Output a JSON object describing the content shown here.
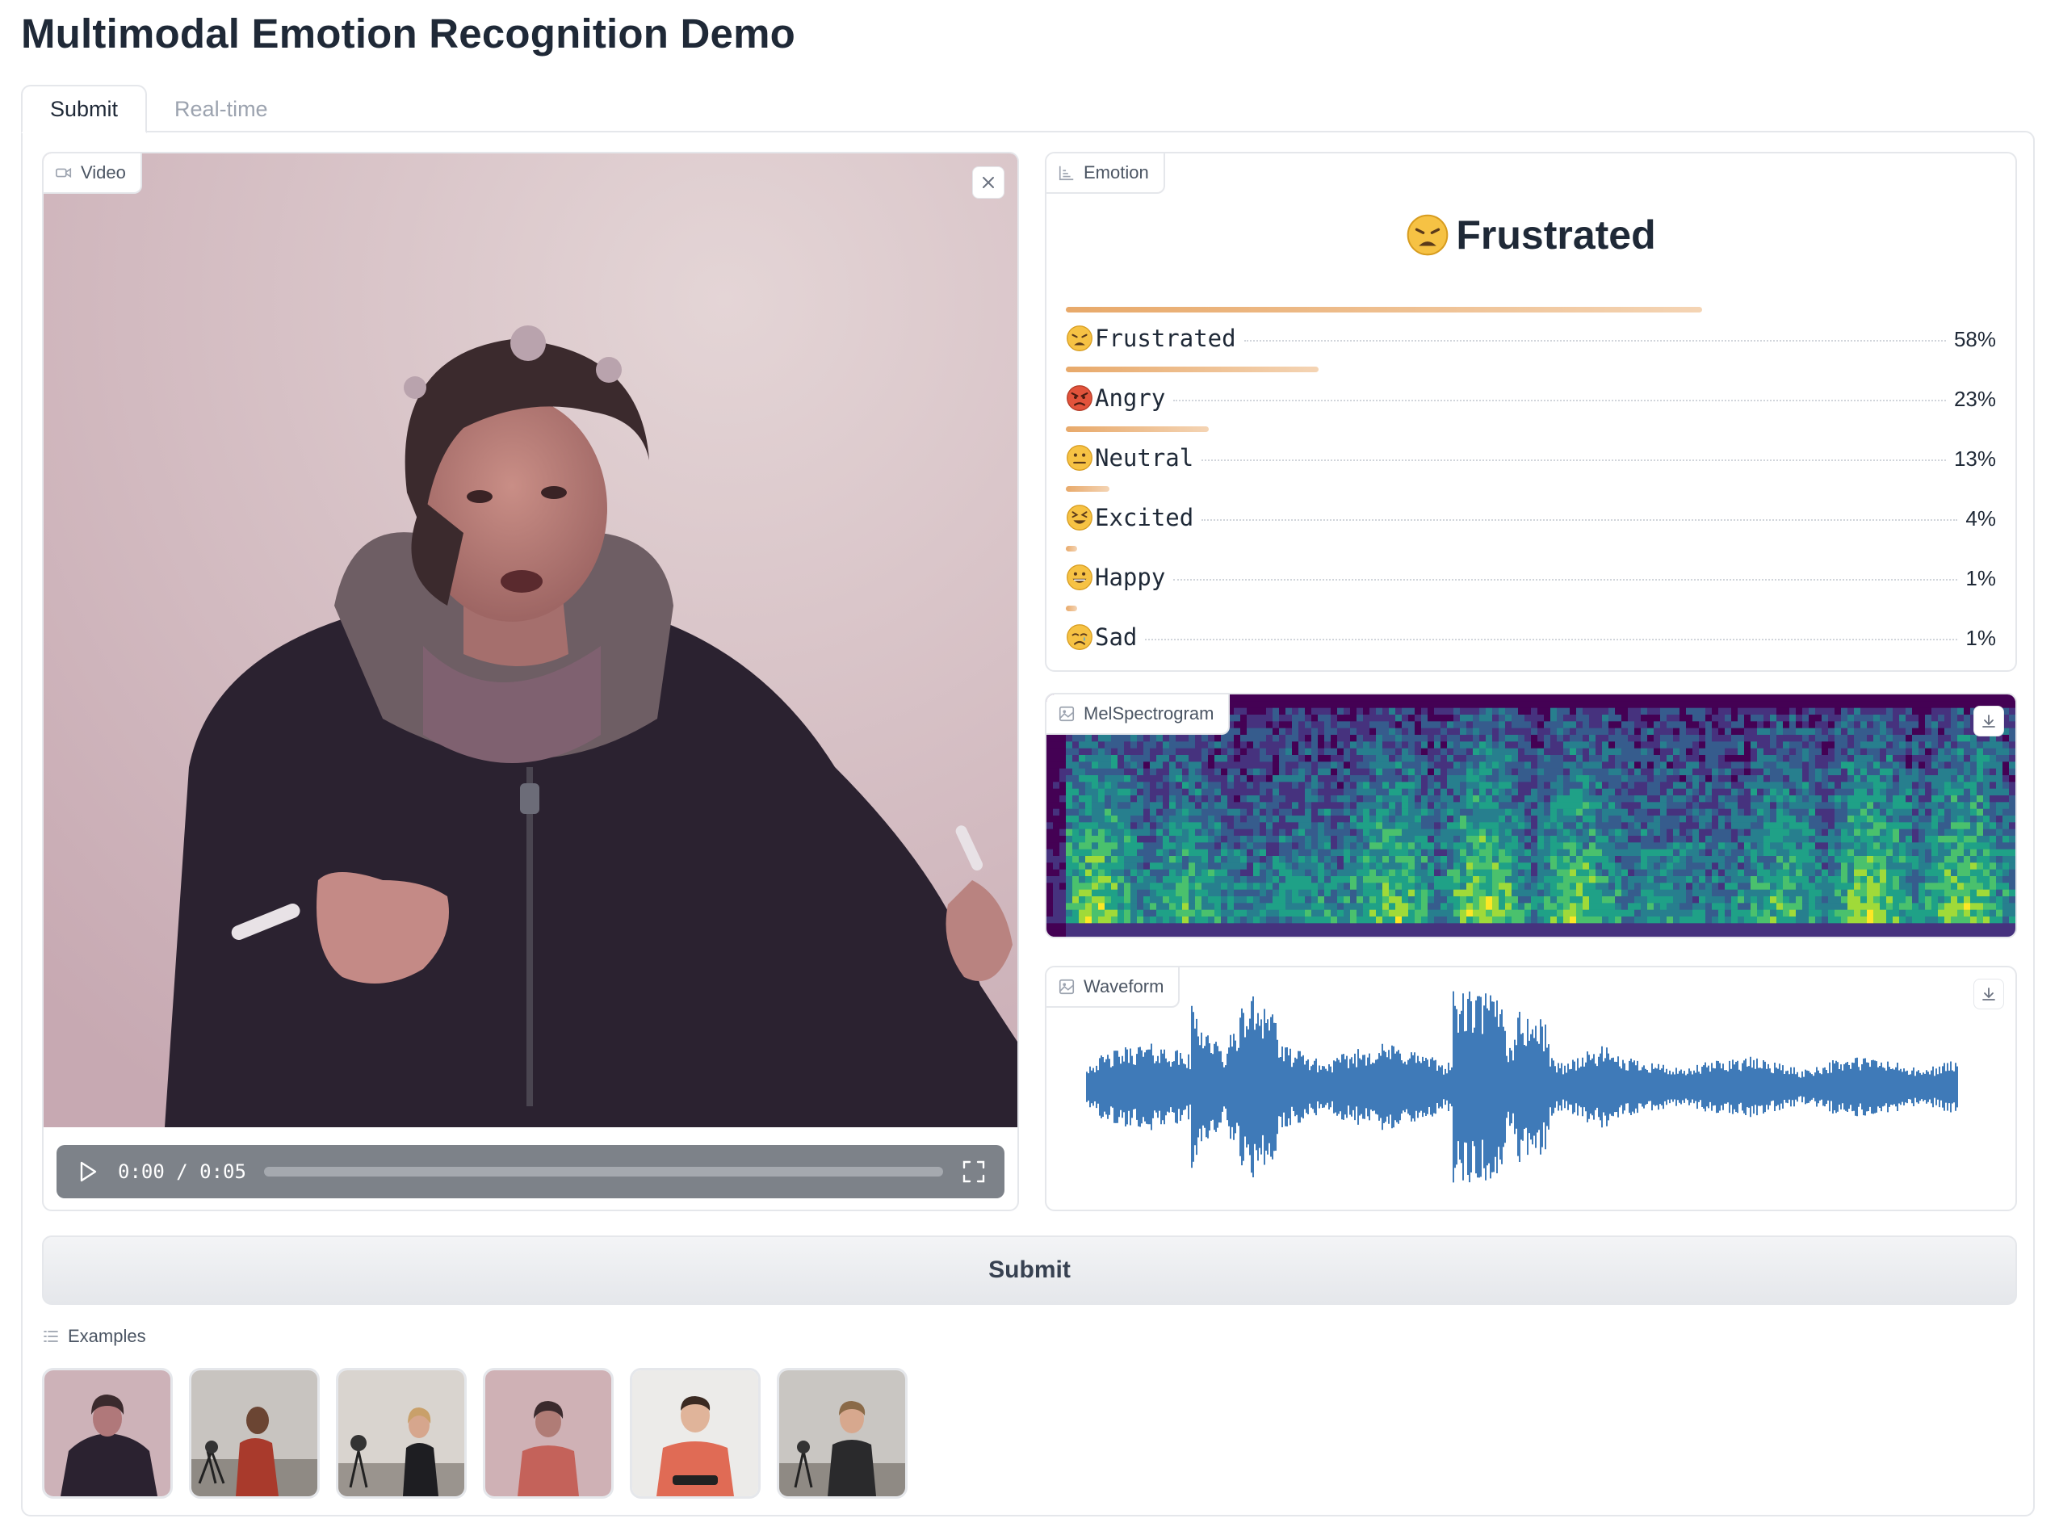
{
  "page": {
    "title": "Multimodal Emotion Recognition Demo"
  },
  "tabs": [
    {
      "label": "Submit",
      "active": true
    },
    {
      "label": "Real-time",
      "active": false
    }
  ],
  "video": {
    "label": "Video",
    "icon": "video-icon",
    "time_display": "0:00 / 0:05",
    "progress_fraction": 0.0
  },
  "emotion": {
    "label": "Emotion",
    "icon": "bar-chart-icon",
    "top_label": "Frustrated",
    "confidences": [
      {
        "name": "Frustrated",
        "percent": 58,
        "display": "58%",
        "emoji": "weary-face"
      },
      {
        "name": "Angry",
        "percent": 23,
        "display": "23%",
        "emoji": "angry-face"
      },
      {
        "name": "Neutral",
        "percent": 13,
        "display": "13%",
        "emoji": "neutral-face"
      },
      {
        "name": "Excited",
        "percent": 4,
        "display": "4%",
        "emoji": "squinting-face"
      },
      {
        "name": "Happy",
        "percent": 1,
        "display": "1%",
        "emoji": "grinning-face"
      },
      {
        "name": "Sad",
        "percent": 1,
        "display": "1%",
        "emoji": "crying-face"
      }
    ],
    "bar_color": "#e8a96a"
  },
  "mel": {
    "label": "MelSpectrogram",
    "icon": "image-icon"
  },
  "waveform": {
    "label": "Waveform",
    "icon": "image-icon",
    "color": "#3f7ab8"
  },
  "submit": {
    "label": "Submit"
  },
  "examples": {
    "label": "Examples",
    "icon": "list-icon",
    "items": [
      {
        "scene": "woman-dark-jacket-pink-wall"
      },
      {
        "scene": "man-red-shirt-studio"
      },
      {
        "scene": "woman-black-top-studio"
      },
      {
        "scene": "woman-red-top-pink-wall"
      },
      {
        "scene": "man-red-polo-white-wall"
      },
      {
        "scene": "man-dark-shirt-studio"
      }
    ]
  }
}
